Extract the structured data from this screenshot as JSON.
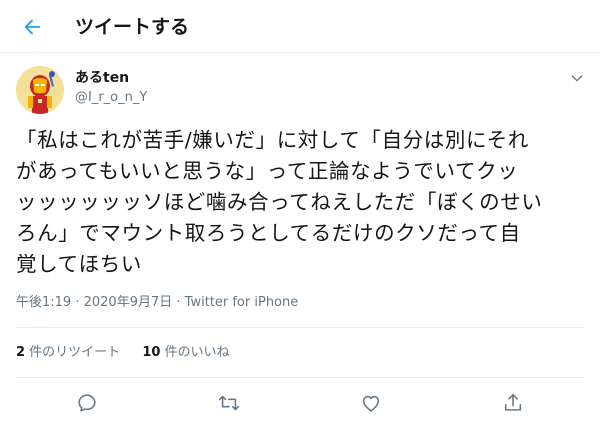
{
  "header": {
    "title": "ツイートする"
  },
  "icons": {
    "back": "arrow-left-icon",
    "more": "chevron-down-icon",
    "reply": "reply-icon",
    "retweet": "retweet-icon",
    "like": "heart-icon",
    "share": "share-icon"
  },
  "colors": {
    "accent": "#1da1f2",
    "muted": "#657786",
    "text": "#14171a",
    "divider": "#e6ecf0"
  },
  "tweet": {
    "author": {
      "display_name": "あるten",
      "handle": "@I_r_o_n_Y"
    },
    "text_lines": [
      "「私はこれが苦手/嫌いだ」に対して「自分は別にそれ",
      "があってもいいと思うな」って正論なようでいてクッ",
      "ッッッッッッソほど噛み合ってねえしただ「ぼくのせい",
      "ろん」でマウント取ろうとしてるだけのクソだって自",
      "覚してほちい"
    ],
    "meta": {
      "time": "午後1:19",
      "separator": " · ",
      "date": "2020年9月7日",
      "source": "Twitter for iPhone"
    },
    "stats": {
      "retweets_count": "2",
      "retweets_label": " 件のリツイート",
      "likes_count": "10",
      "likes_label": " 件のいいね"
    }
  }
}
